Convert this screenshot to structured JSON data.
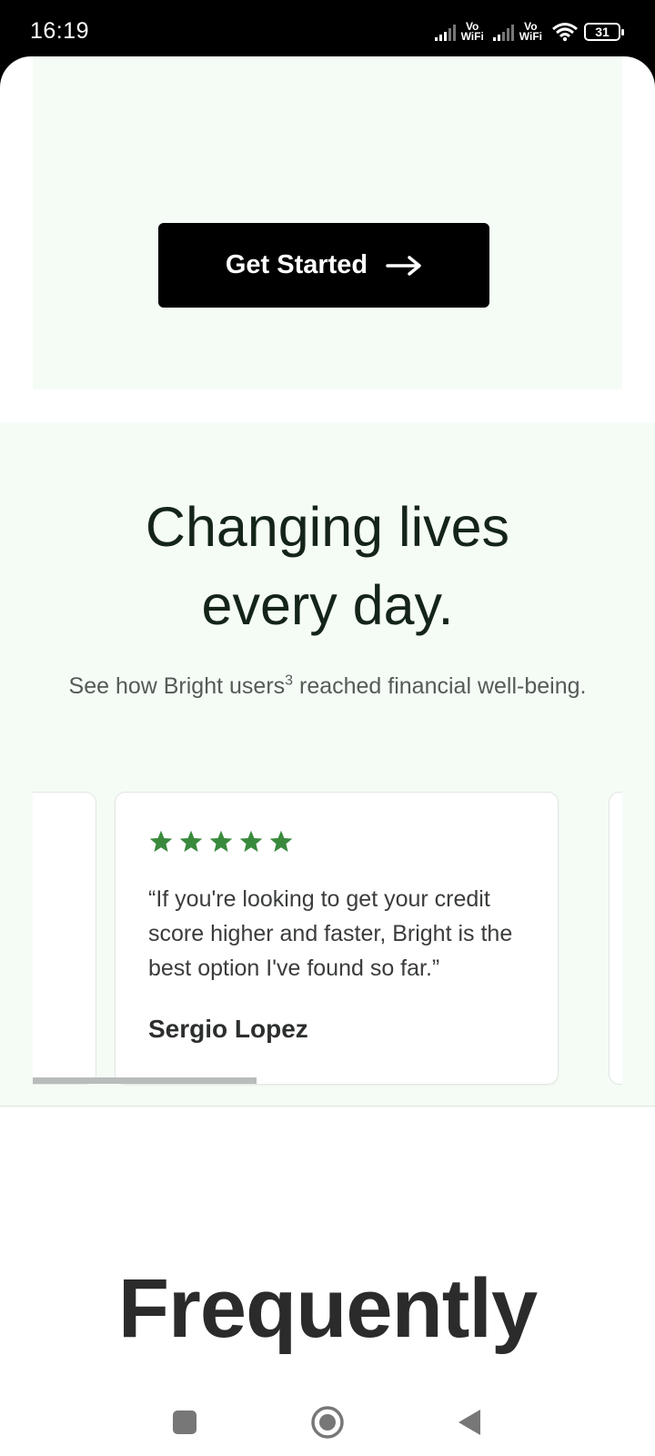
{
  "status_bar": {
    "time": "16:19",
    "vowifi_1": "Vo\nWiFi",
    "vowifi_2": "Vo\nWiFi",
    "battery": "31"
  },
  "hero": {
    "cta_label": "Get Started"
  },
  "testimonials": {
    "title": "Changing lives every day.",
    "subtitle_before": "See how Bright users",
    "subtitle_sup": "3",
    "subtitle_after": " reached financial well-being.",
    "card": {
      "rating": 5,
      "quote": "“If you're looking to get your credit score higher and faster, Bright is the best option I've found so far.”",
      "author": "Sergio Lopez"
    },
    "scroll_position": 0.38
  },
  "faq": {
    "heading": "Frequently"
  },
  "colors": {
    "section_bg": "#f5fcf6",
    "star": "#3a8a3e",
    "title": "#142419",
    "cta_bg": "#000000"
  },
  "icons": {
    "cta": "arrow-right-icon",
    "rating": "star-icon",
    "nav": [
      "square-recents-icon",
      "circle-home-icon",
      "triangle-back-icon"
    ]
  }
}
